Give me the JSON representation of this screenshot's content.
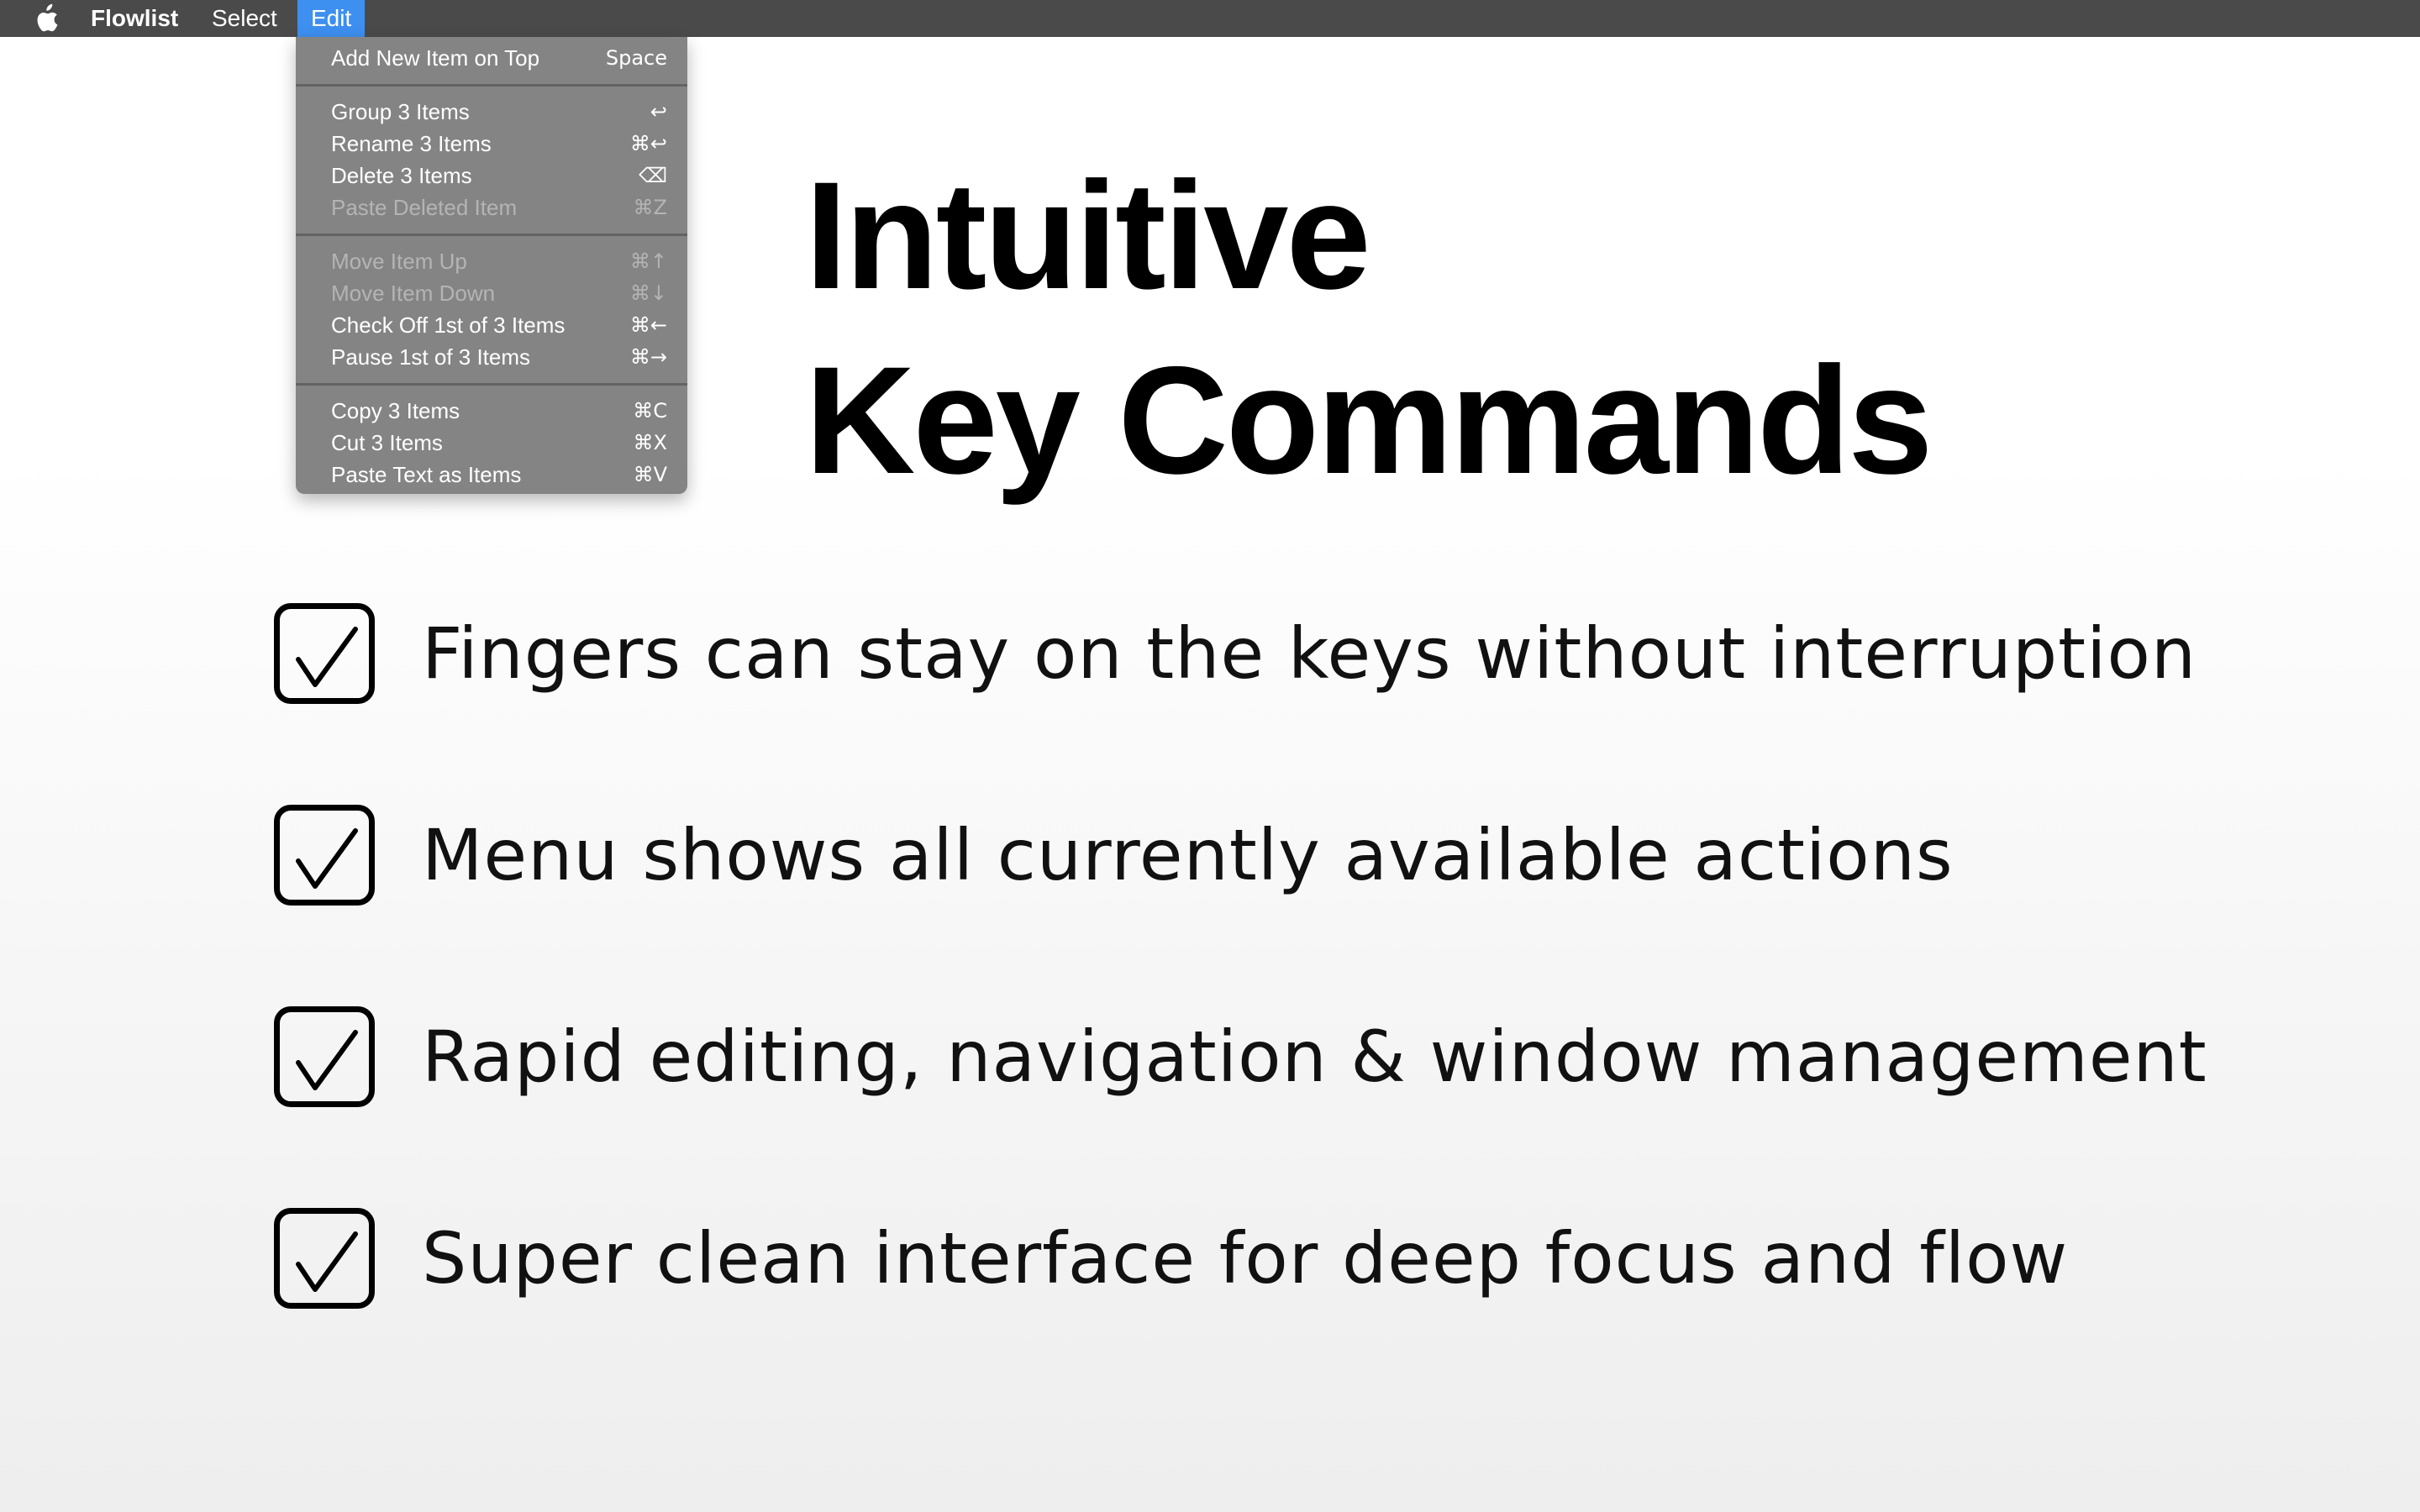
{
  "menubar": {
    "app_name": "Flowlist",
    "menus": [
      "Select",
      "Edit"
    ],
    "active_menu": "Edit",
    "active_color": "#3d8ff0",
    "bar_color": "#4a4a4a"
  },
  "edit_menu": {
    "groups": [
      [
        {
          "label": "Add New Item on Top",
          "shortcut": "Space",
          "enabled": true
        }
      ],
      [
        {
          "label": "Group 3 Items",
          "shortcut": "↩",
          "enabled": true
        },
        {
          "label": "Rename 3 Items",
          "shortcut": "⌘↩",
          "enabled": true
        },
        {
          "label": "Delete 3 Items",
          "shortcut": "⌫",
          "enabled": true
        },
        {
          "label": "Paste Deleted Item",
          "shortcut": "⌘Z",
          "enabled": false
        }
      ],
      [
        {
          "label": "Move Item Up",
          "shortcut": "⌘↑",
          "enabled": false
        },
        {
          "label": "Move Item Down",
          "shortcut": "⌘↓",
          "enabled": false
        },
        {
          "label": "Check Off 1st of 3 Items",
          "shortcut": "⌘←",
          "enabled": true
        },
        {
          "label": "Pause 1st of 3 Items",
          "shortcut": "⌘→",
          "enabled": true
        }
      ],
      [
        {
          "label": "Copy 3 Items",
          "shortcut": "⌘C",
          "enabled": true
        },
        {
          "label": "Cut 3 Items",
          "shortcut": "⌘X",
          "enabled": true
        },
        {
          "label": "Paste Text as Items",
          "shortcut": "⌘V",
          "enabled": true
        }
      ]
    ]
  },
  "hero": {
    "line1": "Intuitive",
    "line2": "Key Commands"
  },
  "features": [
    {
      "text": "Fingers can stay on the keys without interruption",
      "checked": true
    },
    {
      "text": "Menu shows all currently available actions",
      "checked": true
    },
    {
      "text": "Rapid editing, navigation & window management",
      "checked": true
    },
    {
      "text": "Super clean interface for deep focus and flow",
      "checked": true
    }
  ],
  "icons": {
    "apple": "apple-logo-icon",
    "check": "checkmark-icon"
  }
}
